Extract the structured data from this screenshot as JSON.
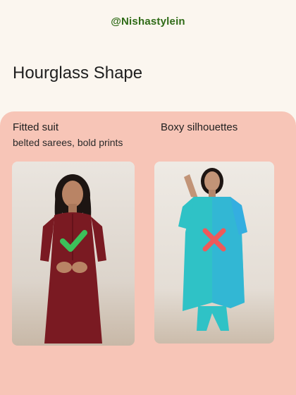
{
  "header": {
    "handle": "@Nishastylein"
  },
  "main": {
    "title": "Hourglass Shape",
    "left": {
      "label": "Fitted suit",
      "sublabel": "belted sarees, bold prints",
      "verdict_icon": "check-icon",
      "image": "woman-maroon-fitted-kurta-photo"
    },
    "right": {
      "label": "Boxy silhouettes",
      "verdict_icon": "cross-icon",
      "image": "woman-teal-boxy-kurta-photo"
    }
  },
  "colors": {
    "background": "#fbf6ef",
    "panel": "#f7c5b7",
    "handle": "#2f6b17",
    "check": "#3cc15a",
    "cross": "#ee5a5a",
    "maroon_kurta": "#7a1a22",
    "teal_kurta": "#2fc2c6"
  }
}
